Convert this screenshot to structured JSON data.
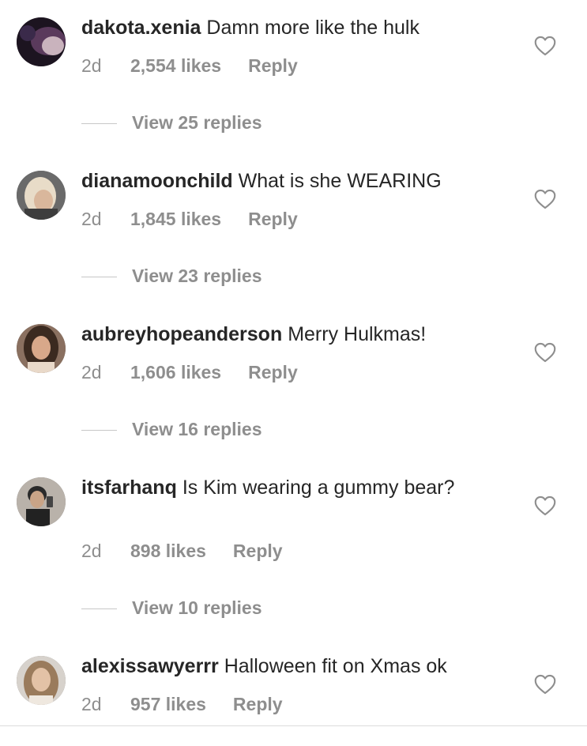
{
  "comments": [
    {
      "username": "dakota.xenia",
      "text": "Damn more like the hulk",
      "time": "2d",
      "likes": "2,554 likes",
      "reply": "Reply",
      "view_replies": "View 25 replies"
    },
    {
      "username": "dianamoonchild",
      "text": "What is she WEARING",
      "time": "2d",
      "likes": "1,845 likes",
      "reply": "Reply",
      "view_replies": "View 23 replies"
    },
    {
      "username": "aubreyhopeanderson",
      "text": "Merry Hulkmas!",
      "time": "2d",
      "likes": "1,606 likes",
      "reply": "Reply",
      "view_replies": "View 16 replies"
    },
    {
      "username": "itsfarhanq",
      "text": "Is Kim wearing a gummy bear?",
      "time": "2d",
      "likes": "898 likes",
      "reply": "Reply",
      "view_replies": "View 10 replies"
    },
    {
      "username": "alexissawyerrr",
      "text": "Halloween fit on Xmas ok",
      "time": "2d",
      "likes": "957 likes",
      "reply": "Reply"
    }
  ],
  "colors": {
    "text": "#262626",
    "secondary": "#8e8e8e",
    "divider": "#dbdbdb"
  },
  "icons": {
    "like": "heart-outline-icon"
  }
}
